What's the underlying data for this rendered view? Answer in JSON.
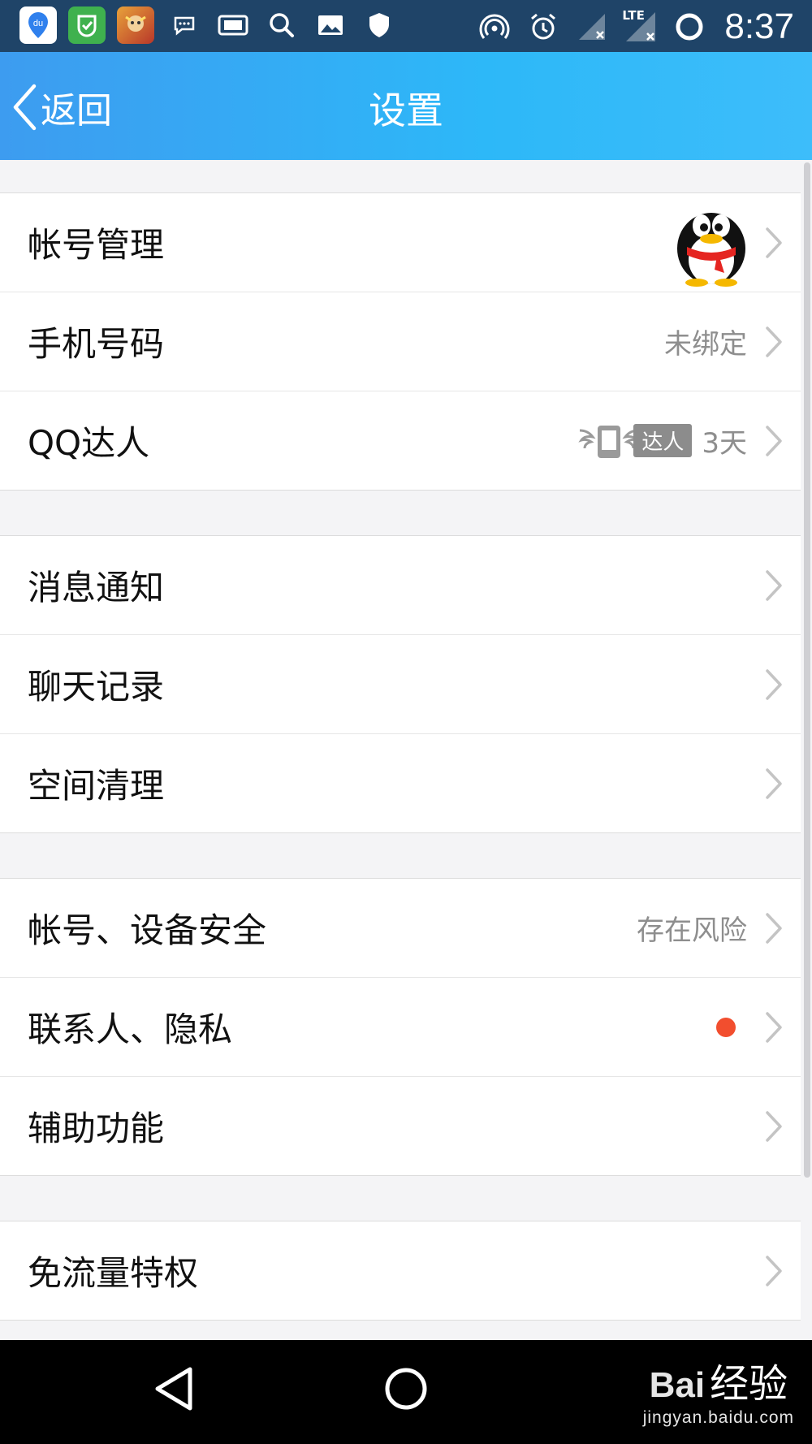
{
  "status_bar": {
    "app_icon_label": "du",
    "network_type": "LTE",
    "time": "8:37"
  },
  "header": {
    "back_label": "返回",
    "title": "设置"
  },
  "groups": [
    {
      "rows": [
        {
          "label": "帐号管理",
          "value": null,
          "has_avatar": true
        },
        {
          "label": "手机号码",
          "value": "未绑定"
        },
        {
          "label": "QQ达人",
          "badge": "达人",
          "value": "3天"
        }
      ]
    },
    {
      "rows": [
        {
          "label": "消息通知"
        },
        {
          "label": "聊天记录"
        },
        {
          "label": "空间清理"
        }
      ]
    },
    {
      "rows": [
        {
          "label": "帐号、设备安全",
          "value": "存在风险"
        },
        {
          "label": "联系人、隐私",
          "has_red_dot": true
        },
        {
          "label": "辅助功能"
        }
      ]
    },
    {
      "rows": [
        {
          "label": "免流量特权"
        }
      ]
    }
  ],
  "watermark": {
    "logo": "Bai",
    "brand": "经验",
    "url": "jingyan.baidu.com"
  },
  "colors": {
    "header_gradient_start": "#3d9cf0",
    "header_gradient_end": "#3dbdfa",
    "red_dot": "#f24e2e",
    "status_bar": "#1f4468"
  }
}
